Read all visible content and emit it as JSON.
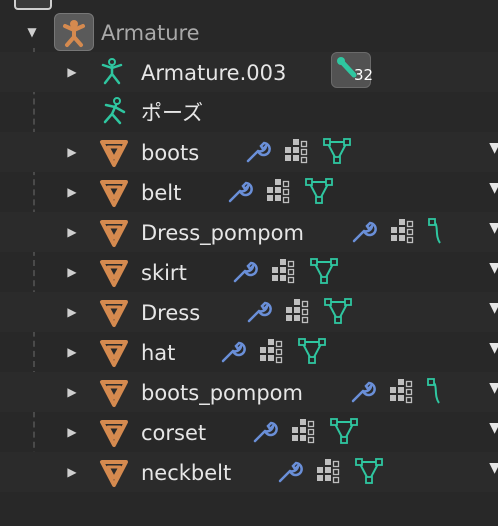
{
  "armature": {
    "label": "Armature"
  },
  "armature_data": {
    "label": "Armature.003",
    "badge_count": "32"
  },
  "pose": {
    "label": "ポーズ"
  },
  "meshes": [
    {
      "label": "boots"
    },
    {
      "label": "belt"
    },
    {
      "label": "Dress_pompom"
    },
    {
      "label": "skirt"
    },
    {
      "label": "Dress"
    },
    {
      "label": "hat"
    },
    {
      "label": "boots_pompom"
    },
    {
      "label": "corset"
    },
    {
      "label": "neckbelt"
    }
  ],
  "icons": {
    "armature_object": "armature-object-icon",
    "armature_data": "armature-data-icon",
    "pose": "pose-icon",
    "mesh": "mesh-object-icon",
    "modifier": "wrench-icon",
    "vertex_groups": "vertex-groups-icon",
    "mesh_data": "mesh-data-icon"
  },
  "colors": {
    "background": "#282828",
    "mesh_orange": "#d58a4f",
    "armature_green": "#2fc6a0",
    "wrench_blue": "#6a8fd8"
  }
}
